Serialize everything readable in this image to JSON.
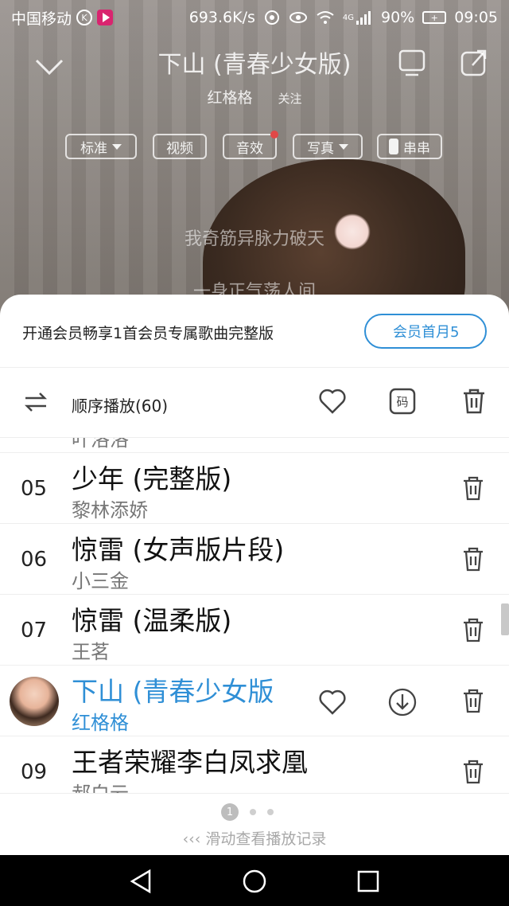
{
  "status": {
    "carrier": "中国移动",
    "speed": "693.6K/s",
    "network": "4G",
    "battery": "90%",
    "time": "09:05"
  },
  "player": {
    "title": "下山 (青春少女版)",
    "artist": "红格格",
    "follow": "关注",
    "pills": {
      "quality": "标准",
      "video": "视频",
      "effect": "音效",
      "photo": "写真",
      "chuan": "串串"
    },
    "lyrics": [
      "我奇筋异脉力破天",
      "一身正气荡人间"
    ]
  },
  "vip": {
    "text": "开通会员畅享1首会员专属歌曲完整版",
    "button": "会员首月5"
  },
  "controls": {
    "mode": "顺序播放(60)",
    "code_icon_label": "码"
  },
  "list": {
    "partial_top_artist": "叶洛洛",
    "rows": [
      {
        "num": "05",
        "name": "少年 (完整版)",
        "artist": "黎林添娇"
      },
      {
        "num": "06",
        "name": "惊雷 (女声版片段)",
        "artist": "小三金"
      },
      {
        "num": "07",
        "name": "惊雷 (温柔版)",
        "artist": "王茗"
      },
      {
        "num": "",
        "name": "下山 (青春少女版",
        "artist": "红格格"
      },
      {
        "num": "09",
        "name": "王者荣耀李白凤求凰",
        "artist": "郝白云"
      }
    ]
  },
  "footer": {
    "page": "1",
    "hint": "滑动查看播放记录"
  },
  "colors": {
    "accent": "#2f8fd6",
    "text": "#222222",
    "muted": "#777777"
  }
}
